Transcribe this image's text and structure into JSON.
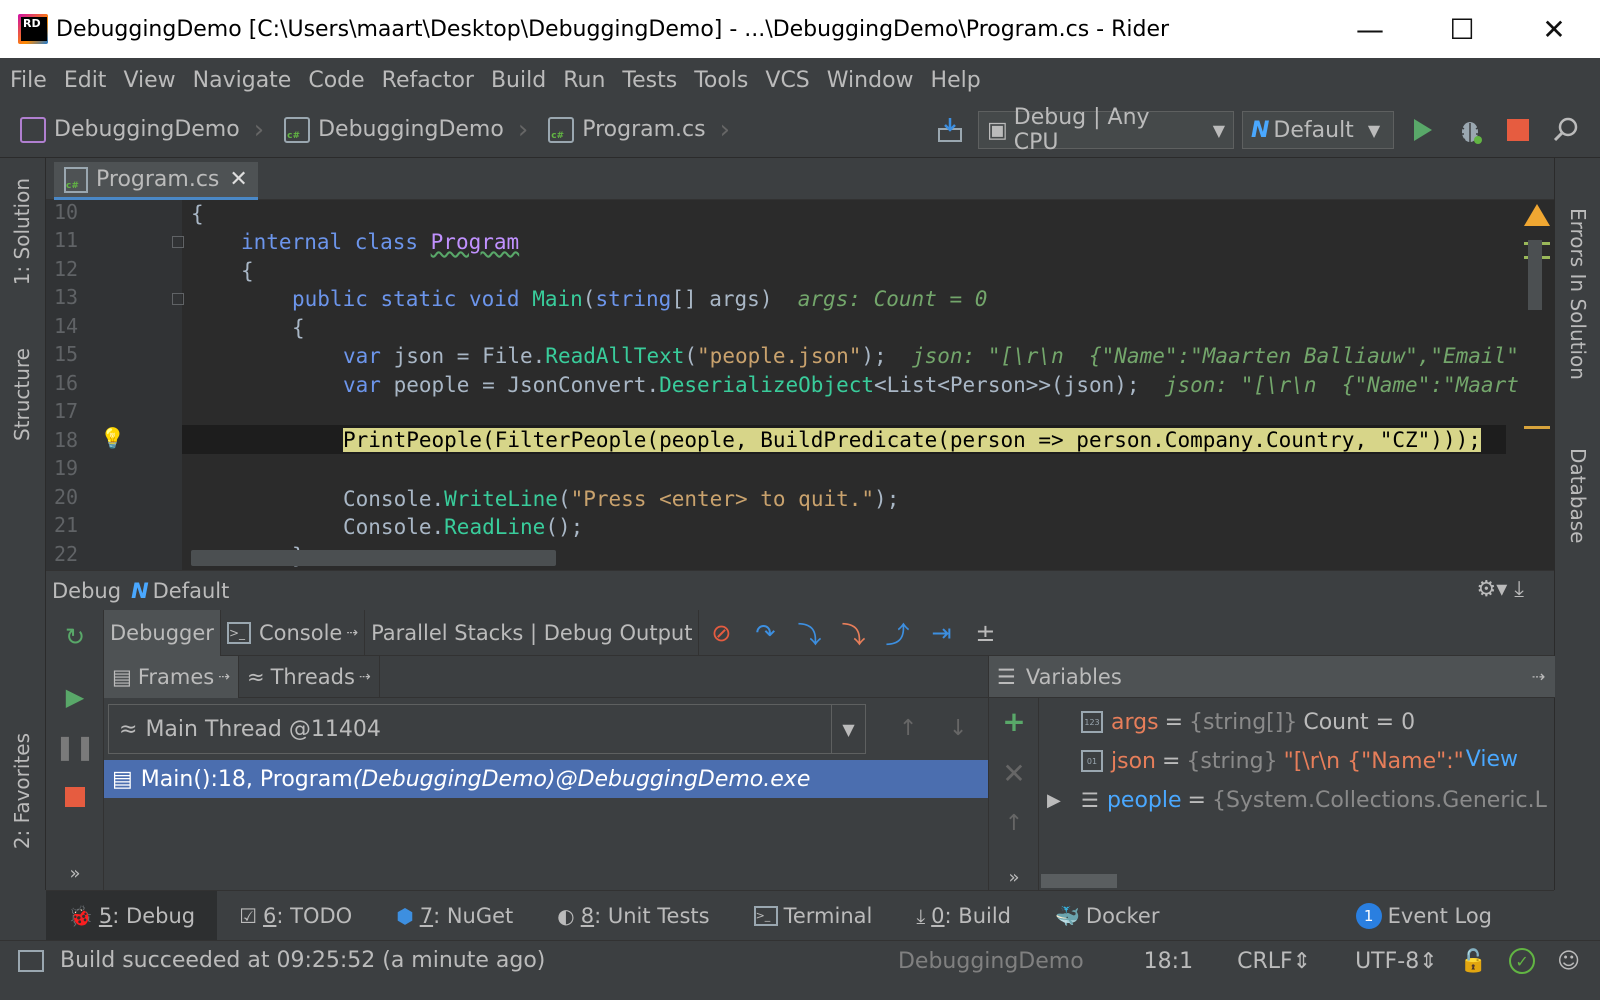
{
  "window": {
    "title": "DebuggingDemo [C:\\Users\\maart\\Desktop\\DebuggingDemo] - ...\\DebuggingDemo\\Program.cs - Rider",
    "minimize": "—",
    "maximize": "☐",
    "close": "✕"
  },
  "menu": [
    "File",
    "Edit",
    "View",
    "Navigate",
    "Code",
    "Refactor",
    "Build",
    "Run",
    "Tests",
    "Tools",
    "VCS",
    "Window",
    "Help"
  ],
  "breadcrumbs": [
    "DebuggingDemo",
    "DebuggingDemo",
    "Program.cs"
  ],
  "toolbar": {
    "config": "Debug | Any CPU",
    "runtime": "Default"
  },
  "left_stripe": [
    "1: Solution",
    "Structure",
    "2: Favorites"
  ],
  "right_stripe": [
    "Errors In Solution",
    "Database"
  ],
  "editor": {
    "tab": "Program.cs",
    "lines": [
      10,
      11,
      12,
      13,
      14,
      15,
      16,
      17,
      18,
      19,
      20,
      21,
      22
    ],
    "code": {
      "l10": "{",
      "l11_kw": "internal class ",
      "l11_cls": "Program",
      "l12": "{",
      "l13_kw": "public static void ",
      "l13_fn": "Main",
      "l13_rest1": "(",
      "l13_kw2": "string",
      "l13_rest2": "[] args)",
      "l13_hint": "args: Count = 0",
      "l14": "{",
      "l15_kw": "var ",
      "l15_a": "json = File.",
      "l15_fn": "ReadAllText",
      "l15_b": "(",
      "l15_str": "\"people.json\"",
      "l15_c": ");",
      "l15_hint": "json: \"[\\r\\n  {\"Name\":\"Maarten Balliauw\",\"Email\"",
      "l16_kw": "var ",
      "l16_a": "people = JsonConvert.",
      "l16_fn": "DeserializeObject",
      "l16_b": "<List<Person>>(json);",
      "l16_hint": "json: \"[\\r\\n  {\"Name\":\"Maart",
      "l18": "PrintPeople(FilterPeople(people, BuildPredicate(person => person.Company.Country, \"CZ\")));",
      "l20_a": "Console.",
      "l20_fn": "WriteLine",
      "l20_b": "(",
      "l20_str": "\"Press <enter> to quit.\"",
      "l20_c": ");",
      "l21_a": "Console.",
      "l21_fn": "ReadLine",
      "l21_b": "();",
      "l22": "}"
    }
  },
  "debug": {
    "title": "Debug",
    "config": "Default",
    "tabs": [
      "Debugger",
      "Console",
      "Parallel Stacks | Debug Output"
    ],
    "frames_tab": "Frames",
    "threads_tab": "Threads",
    "thread": "Main Thread @11404",
    "frame_main": "Main():18, Program ",
    "frame_italic": "(DebuggingDemo)@DebuggingDemo.exe",
    "variables_title": "Variables",
    "variables": [
      {
        "name": "args",
        "type": "{string[]}",
        "value": "Count = 0"
      },
      {
        "name": "json",
        "type": "{string}",
        "value": "\"[\\r\\n  {\"Name\":\"Ma"
      },
      {
        "name": "people",
        "type": "{System.Collections.Generic.L",
        "value": ""
      }
    ],
    "view_link": "View"
  },
  "bottom_tools": [
    {
      "num": "5",
      "label": ": Debug"
    },
    {
      "num": "6",
      "label": ": TODO"
    },
    {
      "num": "7",
      "label": ": NuGet"
    },
    {
      "num": "8",
      "label": ": Unit Tests"
    },
    {
      "num": "",
      "label": "Terminal"
    },
    {
      "num": "0",
      "label": ": Build"
    },
    {
      "num": "",
      "label": "Docker"
    }
  ],
  "event_log": {
    "count": "1",
    "label": "Event Log"
  },
  "status": {
    "message": "Build succeeded at 09:25:52 (a minute ago)",
    "project": "DebuggingDemo",
    "position": "18:1",
    "line_sep": "CRLF",
    "encoding": "UTF-8"
  },
  "colors": {
    "background": "#3c3f41",
    "editor": "#2b2b2b",
    "exec_line": "#d7d589",
    "selection": "#4b6eaf",
    "keyword": "#6c95eb",
    "string": "#c9a26d",
    "accent": "#4aa8ff"
  }
}
